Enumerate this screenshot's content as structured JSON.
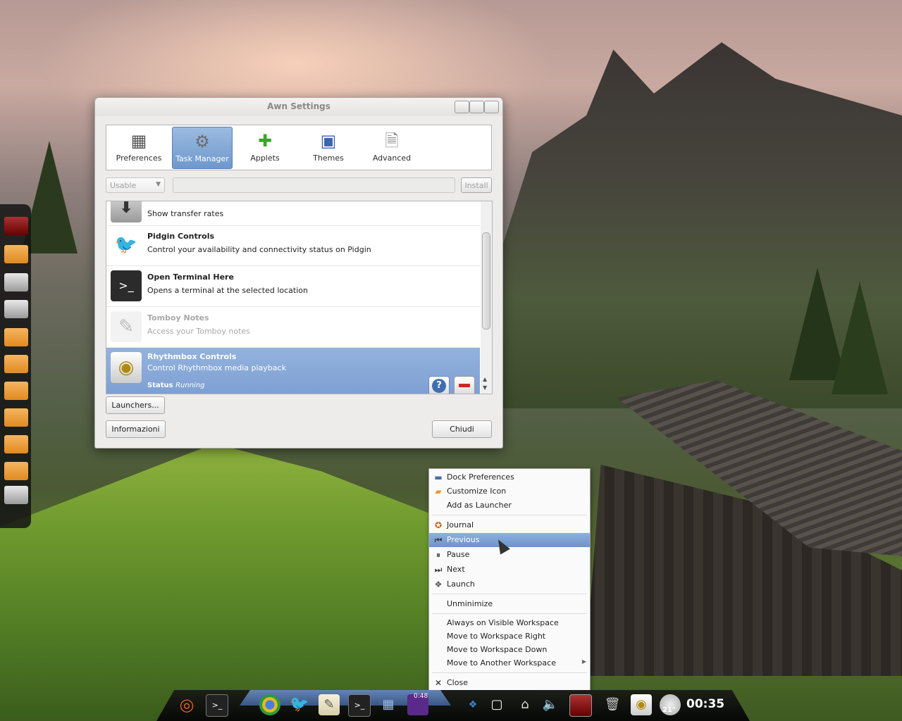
{
  "window": {
    "title": "Awn Settings",
    "tabs": [
      {
        "label": "Preferences",
        "icon": "preferences-icon"
      },
      {
        "label": "Task Manager",
        "icon": "task-manager-gear-icon",
        "active": true
      },
      {
        "label": "Applets",
        "icon": "applets-puzzle-icon"
      },
      {
        "label": "Themes",
        "icon": "themes-icon"
      },
      {
        "label": "Advanced",
        "icon": "advanced-icon"
      }
    ],
    "filter_combo": {
      "value": "Usable"
    },
    "search": {
      "value": ""
    },
    "install_label": "Install",
    "list": [
      {
        "name": "",
        "desc": "Show transfer rates",
        "icon": "download-icon"
      },
      {
        "name": "Pidgin Controls",
        "desc": "Control your availability and connectivity status on Pidgin",
        "icon": "pidgin-icon"
      },
      {
        "name": "Open Terminal Here",
        "desc": "Opens a terminal at the selected location",
        "icon": "terminal-icon"
      },
      {
        "name": "Tomboy Notes",
        "desc": "Access your Tomboy notes",
        "icon": "tomboy-icon",
        "disabled": true
      },
      {
        "name": "Rhythmbox Controls",
        "desc": "Control Rhythmbox media playback",
        "icon": "rhythmbox-icon",
        "selected": true,
        "status_label": "Status",
        "status_value": "Running"
      }
    ],
    "launchers_label": "Launchers...",
    "info_label": "Informazioni",
    "close_label": "Chiudi"
  },
  "context_menu": {
    "items": [
      {
        "label": "Dock Preferences",
        "icon": "dock-preferences-icon"
      },
      {
        "label": "Customize Icon",
        "icon": "folder-icon"
      },
      {
        "label": "Add as Launcher",
        "icon": ""
      },
      {
        "label": "Journal",
        "icon": "journal-icon"
      },
      {
        "label": "Previous",
        "icon": "previous-icon",
        "highlighted": true
      },
      {
        "label": "Pause",
        "icon": "pause-icon"
      },
      {
        "label": "Next",
        "icon": "next-icon"
      },
      {
        "label": "Launch",
        "icon": "launch-icon"
      },
      {
        "label": "Unminimize",
        "icon": ""
      },
      {
        "label": "Always on Visible Workspace",
        "icon": ""
      },
      {
        "label": "Move to Workspace Right",
        "icon": ""
      },
      {
        "label": "Move to Workspace Down",
        "icon": ""
      },
      {
        "label": "Move to Another Workspace",
        "icon": "",
        "submenu": true
      },
      {
        "label": "Close",
        "icon": "close-x-icon"
      }
    ]
  },
  "dock": {
    "clock": "00:35",
    "temperature": "21°",
    "timer": "0:48",
    "items": [
      "ubuntu-icon",
      "terminal-icon",
      "chrome-icon",
      "pidgin-icon",
      "text-editor-icon",
      "terminal-icon",
      "network-icon",
      "media-icon",
      "dropbox-icon",
      "chat-icon",
      "workspace-icon",
      "volume-icon",
      "display-icon",
      "trash-icon",
      "rhythmbox-icon",
      "weather-icon"
    ]
  },
  "colors": {
    "selection": "#7ea0d2",
    "menu_highlight": "#6e93c8"
  }
}
